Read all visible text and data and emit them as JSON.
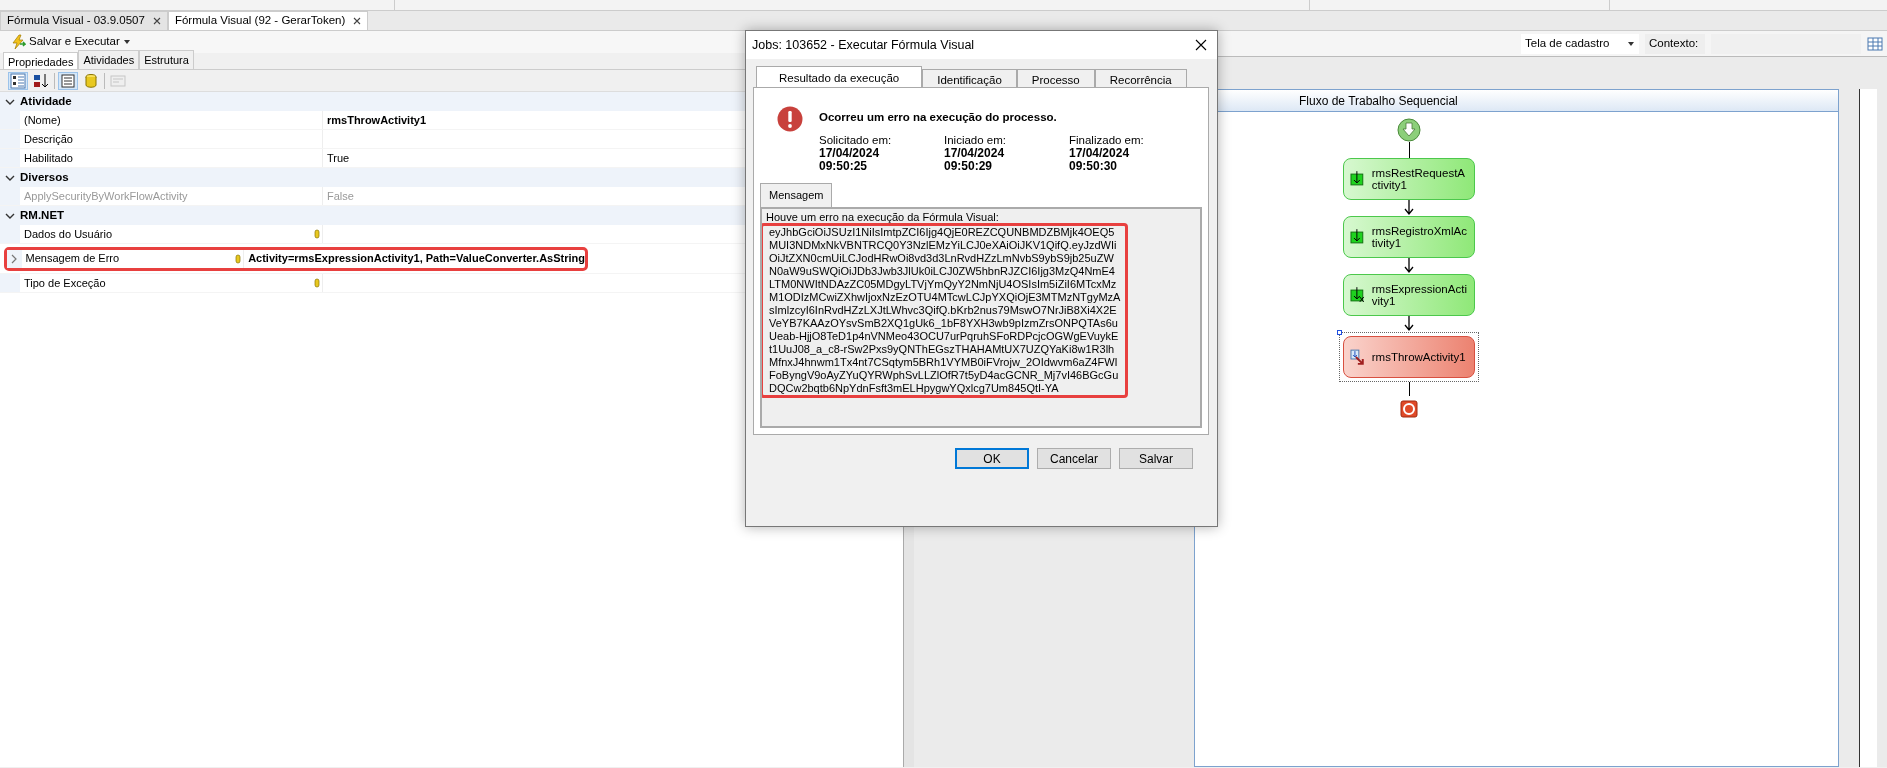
{
  "document_tabs": [
    {
      "label": "Fórmula Visual - 03.9.0507",
      "selected": false
    },
    {
      "label": "Fórmula Visual (92 - GerarToken)",
      "selected": true
    }
  ],
  "toolbar": {
    "run_button": "Salvar e Executar"
  },
  "panel_tabs": [
    {
      "label": "Propriedades",
      "selected": true
    },
    {
      "label": "Atividades",
      "selected": false
    },
    {
      "label": "Estrutura",
      "selected": false
    }
  ],
  "grid_buttons": [
    {
      "kind": "categorized",
      "pressed": true,
      "disabled": false
    },
    {
      "kind": "alphabetical",
      "pressed": false,
      "disabled": false
    },
    {
      "kind": "properties",
      "pressed": true,
      "disabled": false
    },
    {
      "kind": "database",
      "pressed": false,
      "disabled": false
    },
    {
      "kind": "pages",
      "pressed": false,
      "disabled": true
    }
  ],
  "property_grid": [
    {
      "category": "Atividade",
      "expanded": true,
      "properties": [
        {
          "name": "(Nome)",
          "value": "rmsThrowActivity1",
          "modified": true,
          "disabled": false,
          "bound": false,
          "expandable": false,
          "highlighted": false
        },
        {
          "name": "Descrição",
          "disabled": false,
          "bound": false,
          "expandable": false,
          "highlighted": false
        },
        {
          "name": "Habilitado",
          "value": "True",
          "modified": false,
          "disabled": false,
          "bound": false,
          "expandable": false,
          "highlighted": false
        }
      ]
    },
    {
      "category": "Diversos",
      "expanded": true,
      "properties": [
        {
          "name": "ApplySecurityByWorkFlowActivity",
          "value": "False",
          "modified": false,
          "disabled": true,
          "bound": false,
          "expandable": false,
          "highlighted": false
        }
      ]
    },
    {
      "category": "RM.NET",
      "expanded": true,
      "properties": [
        {
          "name": "Dados do Usuário",
          "disabled": false,
          "bound": true,
          "expandable": false,
          "highlighted": false
        },
        {
          "name": "Mensagem de Erro",
          "value": "Activity=rmsExpressionActivity1, Path=ValueConverter.AsString",
          "modified": true,
          "disabled": false,
          "bound": true,
          "expandable": true,
          "highlighted": true
        },
        {
          "name": "Tipo de Exceção",
          "disabled": false,
          "bound": true,
          "expandable": false,
          "highlighted": false
        }
      ]
    }
  ],
  "view_selector": {
    "value": "Tela de cadastro",
    "context_label": "Contexto:"
  },
  "workflow": {
    "title": "Fluxo de Trabalho Sequencial",
    "activities": [
      {
        "name": "rmsRestRequestActivity1",
        "kind": "activity",
        "selected": false
      },
      {
        "name": "rmsRegistroXmlActivity1",
        "kind": "activity",
        "selected": false
      },
      {
        "name": "rmsExpressionActivity1",
        "kind": "expression",
        "selected": false
      },
      {
        "name": "rmsThrowActivity1",
        "kind": "throw",
        "selected": true
      }
    ]
  },
  "dialog": {
    "title": "Jobs: 103652 - Executar Fórmula Visual",
    "tabs": [
      {
        "label": "Resultado da execução",
        "selected": true
      },
      {
        "label": "Identificação",
        "selected": false
      },
      {
        "label": "Processo",
        "selected": false
      },
      {
        "label": "Recorrência",
        "selected": false
      }
    ],
    "status": "Ocorreu um erro na execução do processo.",
    "times": [
      {
        "label": "Solicitado em:",
        "date": "17/04/2024",
        "time": "09:50:25"
      },
      {
        "label": "Iniciado em:",
        "date": "17/04/2024",
        "time": "09:50:29"
      },
      {
        "label": "Finalizado em:",
        "date": "17/04/2024",
        "time": "09:50:30"
      }
    ],
    "message_tab": "Mensagem",
    "message_intro": "Houve um erro na execução da Fórmula Visual:",
    "message_highlighted": true,
    "message_body": "eyJhbGciOiJSUzI1NiIsImtpZCI6Ijg4QjE0REZCQUNBMDZBMjk4OEQ5MUI3NDMxNkVBNTRCQ0Y3NzlEMzYiLCJ0eXAiOiJKV1QifQ.eyJzdWIiOiJtZXN0cmUiLCJodHRwOi8vd3d3LnRvdHZzLmNvbS9ybS9jb25uZWN0aW9uSWQiOiJDb3Jwb3JlUk0iLCJ0ZW5hbnRJZCI6Ijg3MzQ4NmE4LTM0NWItNDAzZC05MDgyLTVjYmQyY2NmNjU4OSIsIm5iZiI6MTcxMzM1ODIzMCwiZXhwIjoxNzEzOTU4MTcwLCJpYXQiOjE3MTMzNTgyMzAsImlzcyI6InRvdHZzLXJtLWhvc3QifQ.bKrb2nus79MswO7NrJiB8Xi4X2EVeYB7KAAzOYsvSmB2XQ1gUk6_1bF8YXH3wb9pIzmZrsONPQTAs6uUeab-HjjO8TeD1p4nVNMeo43OCU7urPqruhSFoRDPcjcOGWgEVuykEt1UuJ08_a_c8-rSw2Pxs9yQNThEGszTHAHAMtUX7UZQYaKi8w1R3lhMfnxJ4hnwm1Tx4nt7CSqtym5BRh1VYMB0iFVrojw_2OIdwvm6aZ4FWIFoByngV9oAyZYuQYRWphSvLLZlOfR7t5yD4acGCNR_Mj7vI46BGcGuDQCw2bqtb6NpYdnFsft3mELHpygwYQxlcg7Um845QtI-YA",
    "buttons": [
      {
        "label": "OK",
        "default": true
      },
      {
        "label": "Cancelar",
        "default": false
      },
      {
        "label": "Salvar",
        "default": false
      }
    ]
  }
}
